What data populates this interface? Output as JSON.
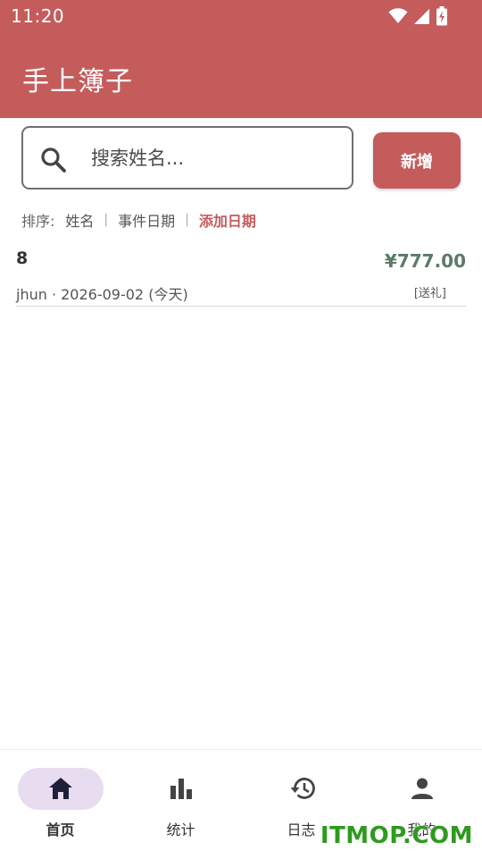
{
  "status_bar": {
    "time": "11:20",
    "icons": [
      "wifi-icon",
      "cell-signal-icon",
      "battery-charging-icon"
    ]
  },
  "header": {
    "title": "手上簿子"
  },
  "search": {
    "placeholder": "搜索姓名...",
    "value": ""
  },
  "toolbar": {
    "add_label": "新增"
  },
  "sort": {
    "label": "排序:",
    "options": [
      "姓名",
      "事件日期",
      "添加日期"
    ],
    "active": "添加日期"
  },
  "records": [
    {
      "name": "8",
      "amount": "¥777.00",
      "meta": "jhun · 2026-09-02 (今天)",
      "type": "[送礼]"
    }
  ],
  "bottom_nav": {
    "items": [
      {
        "label": "首页",
        "icon": "home-icon",
        "active": true
      },
      {
        "label": "统计",
        "icon": "bar-chart-icon",
        "active": false
      },
      {
        "label": "日志",
        "icon": "history-icon",
        "active": false
      },
      {
        "label": "我的",
        "icon": "person-icon",
        "active": false
      }
    ]
  },
  "watermark": "ITMOP.COM",
  "colors": {
    "primary": "#c45c5c",
    "amount": "#5c7a67",
    "nav_active_bg": "#e7dcf0",
    "watermark": "#2e9a1f"
  }
}
